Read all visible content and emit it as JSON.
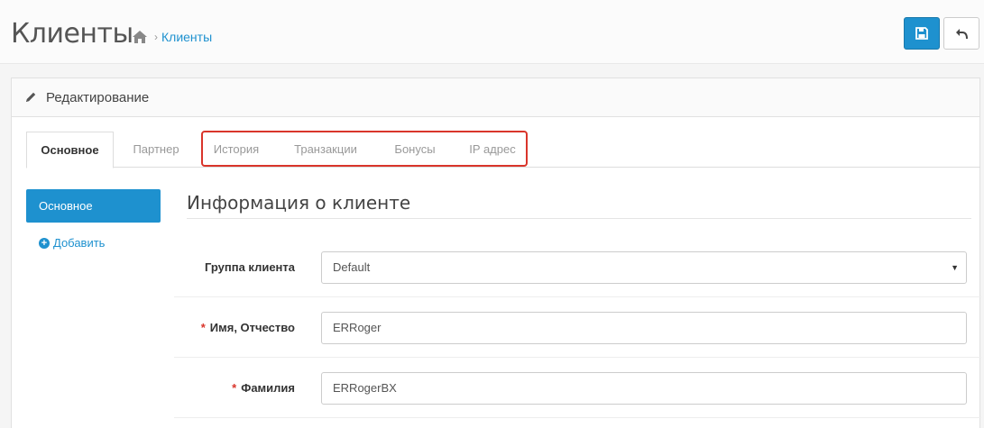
{
  "header": {
    "title": "Клиенты",
    "breadcrumb": {
      "home_icon": "home-icon",
      "separator": "›",
      "current": "Клиенты"
    },
    "buttons": {
      "save_icon": "floppy-disk-icon",
      "back_icon": "reply-icon"
    },
    "colors": {
      "primary": "#1e91cf",
      "highlight": "#d9352b"
    }
  },
  "panel": {
    "heading_icon": "pencil-icon",
    "heading": "Редактирование"
  },
  "tabs": [
    {
      "label": "Основное",
      "active": true
    },
    {
      "label": "Партнер",
      "active": false
    },
    {
      "label": "История",
      "active": false
    },
    {
      "label": "Транзакции",
      "active": false
    },
    {
      "label": "Бонусы",
      "active": false
    },
    {
      "label": "IP адрес",
      "active": false
    }
  ],
  "subnav": {
    "active_item": "Основное",
    "add_icon": "plus-circle-icon",
    "add_label": "Добавить"
  },
  "form": {
    "section_title": "Информация о клиенте",
    "fields": [
      {
        "label": "Группа клиента",
        "required": false,
        "value": "Default",
        "type": "select"
      },
      {
        "label": "Имя, Отчество",
        "required": true,
        "value": "ERRoger",
        "type": "text"
      },
      {
        "label": "Фамилия",
        "required": true,
        "value": "ERRogerBX",
        "type": "text"
      }
    ]
  }
}
